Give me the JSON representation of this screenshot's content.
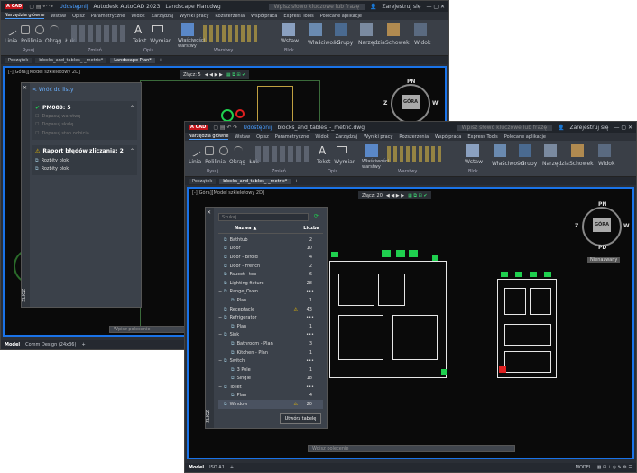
{
  "back_window": {
    "app_title": "Autodesk AutoCAD 2023",
    "drawing_title": "Landscape Plan.dwg",
    "share": "Udostępnij",
    "search_placeholder": "Wpisz słowo kluczowe lub frazę",
    "signin": "Zarejestruj się",
    "menu": [
      "Narzędzia główne",
      "Wstaw",
      "Opisz",
      "Parametryczne",
      "Widok",
      "Zarządzaj",
      "Wyniki pracy",
      "Rozszerzenia",
      "Współpraca",
      "Express Tools",
      "Polecane aplikacje"
    ],
    "ribbon_tools": [
      "Linia",
      "Polilinia",
      "Okrąg",
      "Łuk",
      "Tekst",
      "Wymiar",
      "Właściwości warstwy",
      "Wstaw",
      "Właściwości",
      "Grupy",
      "Narzędzia",
      "Schowek",
      "Widok"
    ],
    "ribbon_groups": [
      "Rysuj",
      "Zmień",
      "Opis",
      "Warstwy",
      "Blok"
    ],
    "doc_tabs": [
      "Początek",
      "blocks_and_tables_-_metric*",
      "Landscape Plan*"
    ],
    "viewport_label": "[-][Góra][Model szkieletowy 2D]",
    "zoom_label": "Złącz: 5",
    "viewcube": {
      "face": "GÓRA",
      "n": "PN",
      "s": "PD",
      "e": "W",
      "w": "Z"
    },
    "panel": {
      "back_link": "< Wróć do listy",
      "pmo_title": "PM089: 5",
      "pmo_items": [
        "Dopasuj warstwę",
        "Dopasuj skalę",
        "Dopasuj stan odbicia"
      ],
      "report_title": "Raport błędów zliczania: 2",
      "report_items": [
        "Rozbity blok",
        "Rozbity blok"
      ],
      "side_label": "ZLICZ"
    },
    "command_placeholder": "Wpisz polecenie",
    "status_tabs": [
      "Model",
      "Comm Design (24x36)"
    ]
  },
  "front_window": {
    "drawing_title": "blocks_and_tables_-_metric.dwg",
    "share": "Udostępnij",
    "search_placeholder": "Wpisz słowo kluczowe lub frazę",
    "signin": "Zarejestruj się",
    "menu": [
      "Narzędzia główne",
      "Wstaw",
      "Opisz",
      "Parametryczne",
      "Widok",
      "Zarządzaj",
      "Wyniki pracy",
      "Rozszerzenia",
      "Współpraca",
      "Express Tools",
      "Polecane aplikacje"
    ],
    "ribbon_tools": [
      "Linia",
      "Polilinia",
      "Okrąg",
      "Łuk",
      "Tekst",
      "Wymiar",
      "Właściwości warstwy",
      "Wstaw",
      "Właściwości",
      "Grupy",
      "Narzędzia",
      "Schowek",
      "Widok"
    ],
    "ribbon_groups": [
      "Rysuj",
      "Zmień",
      "Opis",
      "Warstwy",
      "Blok"
    ],
    "doc_tabs": [
      "Początek",
      "blocks_and_tables_-_metric*"
    ],
    "viewport_label": "[-][Góra][Model szkieletowy 2D]",
    "zoom_label": "Złącz: 20",
    "viewcube": {
      "face": "GÓRA",
      "n": "PN",
      "s": "PD",
      "e": "W",
      "w": "Z",
      "label": "Nienazwany"
    },
    "panel": {
      "search_placeholder": "Szukaj",
      "col_name": "Nazwa",
      "col_count": "Liczba",
      "rows": [
        {
          "name": "Bathtub",
          "count": "2",
          "indent": 0,
          "warn": false,
          "expand": false
        },
        {
          "name": "Door",
          "count": "10",
          "indent": 0,
          "warn": false,
          "expand": false
        },
        {
          "name": "Door - Bifold",
          "count": "4",
          "indent": 0,
          "warn": false,
          "expand": false
        },
        {
          "name": "Door - French",
          "count": "2",
          "indent": 0,
          "warn": false,
          "expand": false
        },
        {
          "name": "Faucet - top",
          "count": "6",
          "indent": 0,
          "warn": false,
          "expand": false
        },
        {
          "name": "Lighting fixture",
          "count": "28",
          "indent": 0,
          "warn": false,
          "expand": false
        },
        {
          "name": "Range_Oven",
          "count": "",
          "indent": 0,
          "warn": false,
          "expand": true
        },
        {
          "name": "Plan",
          "count": "1",
          "indent": 1,
          "warn": false,
          "expand": false
        },
        {
          "name": "Receptacle",
          "count": "43",
          "indent": 0,
          "warn": true,
          "expand": false
        },
        {
          "name": "Refrigerator",
          "count": "",
          "indent": 0,
          "warn": false,
          "expand": true
        },
        {
          "name": "Plan",
          "count": "1",
          "indent": 1,
          "warn": false,
          "expand": false
        },
        {
          "name": "Sink",
          "count": "",
          "indent": 0,
          "warn": false,
          "expand": true
        },
        {
          "name": "Bathroom - Plan",
          "count": "3",
          "indent": 1,
          "warn": false,
          "expand": false
        },
        {
          "name": "Kitchen - Plan",
          "count": "1",
          "indent": 1,
          "warn": false,
          "expand": false
        },
        {
          "name": "Switch",
          "count": "",
          "indent": 0,
          "warn": false,
          "expand": true
        },
        {
          "name": "3 Pole",
          "count": "1",
          "indent": 1,
          "warn": false,
          "expand": false
        },
        {
          "name": "Single",
          "count": "18",
          "indent": 1,
          "warn": false,
          "expand": false
        },
        {
          "name": "Toilet",
          "count": "",
          "indent": 0,
          "warn": false,
          "expand": true
        },
        {
          "name": "Plan",
          "count": "4",
          "indent": 1,
          "warn": false,
          "expand": false
        },
        {
          "name": "Window",
          "count": "20",
          "indent": 0,
          "warn": true,
          "expand": false
        }
      ],
      "create_table": "Utwórz tabelę",
      "side_label": "ZLICZ"
    },
    "command_placeholder": "Wpisz polecenie",
    "status_tabs": [
      "Model",
      "ISO A1"
    ],
    "status_right": "MODEL"
  },
  "colors": {
    "accent": "#1a73e8",
    "count_green": "#1fd04f",
    "autocad_red": "#c4161c",
    "warning": "#f0c000"
  }
}
